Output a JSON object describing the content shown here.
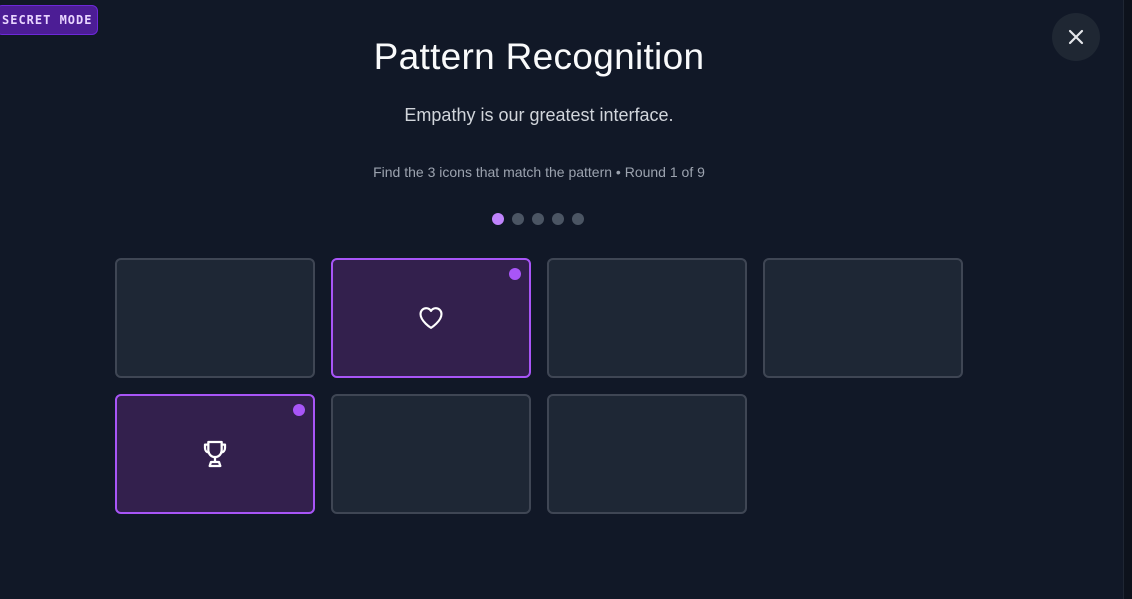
{
  "badge": {
    "label": "SECRET MODE"
  },
  "header": {
    "title": "Pattern Recognition",
    "subtitle": "Empathy is our greatest interface.",
    "instructions": "Find the 3 icons that match the pattern • Round 1 of 9"
  },
  "progress": {
    "total_dots": 5,
    "active_index": 0
  },
  "colors": {
    "background": "#111827",
    "card": "#1e2735",
    "card_border": "#3f4654",
    "selected_card": "#33204d",
    "accent": "#a855f7",
    "badge": "#4c1d95"
  },
  "cards": [
    {
      "selected": false,
      "icon": null
    },
    {
      "selected": true,
      "icon": "heart-icon"
    },
    {
      "selected": false,
      "icon": null
    },
    {
      "selected": false,
      "icon": null
    },
    {
      "selected": true,
      "icon": "trophy-icon"
    },
    {
      "selected": false,
      "icon": null
    },
    {
      "selected": false,
      "icon": null
    }
  ]
}
